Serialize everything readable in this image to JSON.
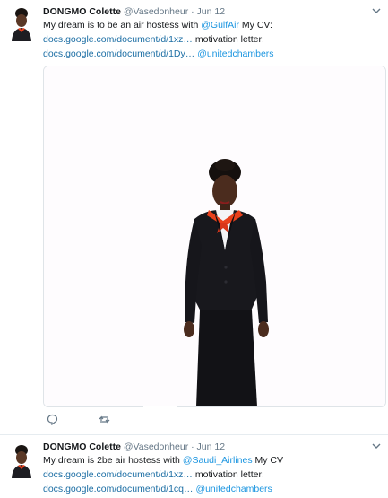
{
  "tweets": [
    {
      "author_name": "DONGMO Colette",
      "handle": "@Vasedonheur",
      "separator": "·",
      "date": "Jun 12",
      "line1_text": "My dream is to be an air hostess with ",
      "line1_mention": "@GulfAir",
      "line1_tail": " My CV:",
      "line2_link": "docs.google.com/document/d/1xz…",
      "line2_tail": " motivation letter:",
      "line3_link": "docs.google.com/document/d/1Dy…",
      "line3_mention": "@unitedchambers",
      "icons": {
        "menu": "chevron-down-icon",
        "reply": "reply-icon",
        "retweet": "retweet-icon"
      }
    },
    {
      "author_name": "DONGMO Colette",
      "handle": "@Vasedonheur",
      "separator": "·",
      "date": "Jun 12",
      "line1_text": "My dream is 2be air hostess with ",
      "line1_mention": "@Saudi_Airlines",
      "line1_tail": " My CV",
      "line2_link": "docs.google.com/document/d/1xz…",
      "line2_tail": " motivation letter:",
      "line3_link": "docs.google.com/document/d/1cq…",
      "line3_mention": "@unitedchambers"
    }
  ],
  "colors": {
    "link": "#1b95e0",
    "muted": "#657786",
    "text": "#14171a",
    "uniform_scarf": "#e8401c"
  }
}
